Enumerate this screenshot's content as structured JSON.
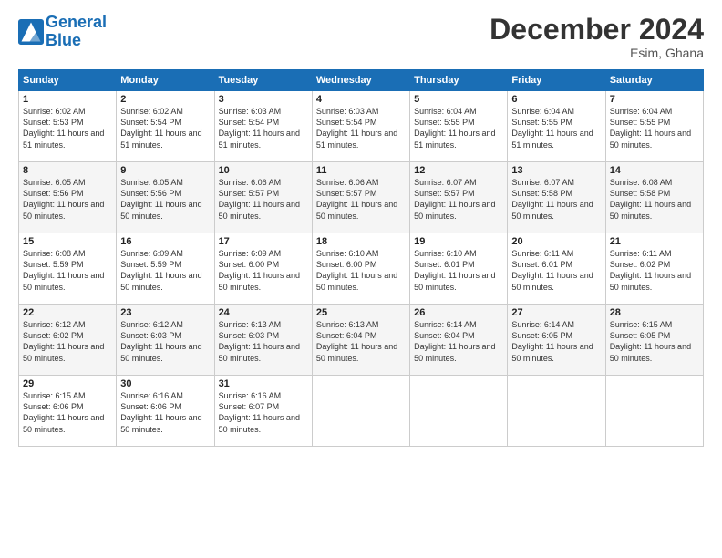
{
  "logo": {
    "line1": "General",
    "line2": "Blue"
  },
  "title": "December 2024",
  "location": "Esim, Ghana",
  "headers": [
    "Sunday",
    "Monday",
    "Tuesday",
    "Wednesday",
    "Thursday",
    "Friday",
    "Saturday"
  ],
  "weeks": [
    [
      {
        "day": "1",
        "sunrise": "6:02 AM",
        "sunset": "5:53 PM",
        "daylight": "11 hours and 51 minutes."
      },
      {
        "day": "2",
        "sunrise": "6:02 AM",
        "sunset": "5:54 PM",
        "daylight": "11 hours and 51 minutes."
      },
      {
        "day": "3",
        "sunrise": "6:03 AM",
        "sunset": "5:54 PM",
        "daylight": "11 hours and 51 minutes."
      },
      {
        "day": "4",
        "sunrise": "6:03 AM",
        "sunset": "5:54 PM",
        "daylight": "11 hours and 51 minutes."
      },
      {
        "day": "5",
        "sunrise": "6:04 AM",
        "sunset": "5:55 PM",
        "daylight": "11 hours and 51 minutes."
      },
      {
        "day": "6",
        "sunrise": "6:04 AM",
        "sunset": "5:55 PM",
        "daylight": "11 hours and 51 minutes."
      },
      {
        "day": "7",
        "sunrise": "6:04 AM",
        "sunset": "5:55 PM",
        "daylight": "11 hours and 50 minutes."
      }
    ],
    [
      {
        "day": "8",
        "sunrise": "6:05 AM",
        "sunset": "5:56 PM",
        "daylight": "11 hours and 50 minutes."
      },
      {
        "day": "9",
        "sunrise": "6:05 AM",
        "sunset": "5:56 PM",
        "daylight": "11 hours and 50 minutes."
      },
      {
        "day": "10",
        "sunrise": "6:06 AM",
        "sunset": "5:57 PM",
        "daylight": "11 hours and 50 minutes."
      },
      {
        "day": "11",
        "sunrise": "6:06 AM",
        "sunset": "5:57 PM",
        "daylight": "11 hours and 50 minutes."
      },
      {
        "day": "12",
        "sunrise": "6:07 AM",
        "sunset": "5:57 PM",
        "daylight": "11 hours and 50 minutes."
      },
      {
        "day": "13",
        "sunrise": "6:07 AM",
        "sunset": "5:58 PM",
        "daylight": "11 hours and 50 minutes."
      },
      {
        "day": "14",
        "sunrise": "6:08 AM",
        "sunset": "5:58 PM",
        "daylight": "11 hours and 50 minutes."
      }
    ],
    [
      {
        "day": "15",
        "sunrise": "6:08 AM",
        "sunset": "5:59 PM",
        "daylight": "11 hours and 50 minutes."
      },
      {
        "day": "16",
        "sunrise": "6:09 AM",
        "sunset": "5:59 PM",
        "daylight": "11 hours and 50 minutes."
      },
      {
        "day": "17",
        "sunrise": "6:09 AM",
        "sunset": "6:00 PM",
        "daylight": "11 hours and 50 minutes."
      },
      {
        "day": "18",
        "sunrise": "6:10 AM",
        "sunset": "6:00 PM",
        "daylight": "11 hours and 50 minutes."
      },
      {
        "day": "19",
        "sunrise": "6:10 AM",
        "sunset": "6:01 PM",
        "daylight": "11 hours and 50 minutes."
      },
      {
        "day": "20",
        "sunrise": "6:11 AM",
        "sunset": "6:01 PM",
        "daylight": "11 hours and 50 minutes."
      },
      {
        "day": "21",
        "sunrise": "6:11 AM",
        "sunset": "6:02 PM",
        "daylight": "11 hours and 50 minutes."
      }
    ],
    [
      {
        "day": "22",
        "sunrise": "6:12 AM",
        "sunset": "6:02 PM",
        "daylight": "11 hours and 50 minutes."
      },
      {
        "day": "23",
        "sunrise": "6:12 AM",
        "sunset": "6:03 PM",
        "daylight": "11 hours and 50 minutes."
      },
      {
        "day": "24",
        "sunrise": "6:13 AM",
        "sunset": "6:03 PM",
        "daylight": "11 hours and 50 minutes."
      },
      {
        "day": "25",
        "sunrise": "6:13 AM",
        "sunset": "6:04 PM",
        "daylight": "11 hours and 50 minutes."
      },
      {
        "day": "26",
        "sunrise": "6:14 AM",
        "sunset": "6:04 PM",
        "daylight": "11 hours and 50 minutes."
      },
      {
        "day": "27",
        "sunrise": "6:14 AM",
        "sunset": "6:05 PM",
        "daylight": "11 hours and 50 minutes."
      },
      {
        "day": "28",
        "sunrise": "6:15 AM",
        "sunset": "6:05 PM",
        "daylight": "11 hours and 50 minutes."
      }
    ],
    [
      {
        "day": "29",
        "sunrise": "6:15 AM",
        "sunset": "6:06 PM",
        "daylight": "11 hours and 50 minutes."
      },
      {
        "day": "30",
        "sunrise": "6:16 AM",
        "sunset": "6:06 PM",
        "daylight": "11 hours and 50 minutes."
      },
      {
        "day": "31",
        "sunrise": "6:16 AM",
        "sunset": "6:07 PM",
        "daylight": "11 hours and 50 minutes."
      },
      null,
      null,
      null,
      null
    ]
  ]
}
